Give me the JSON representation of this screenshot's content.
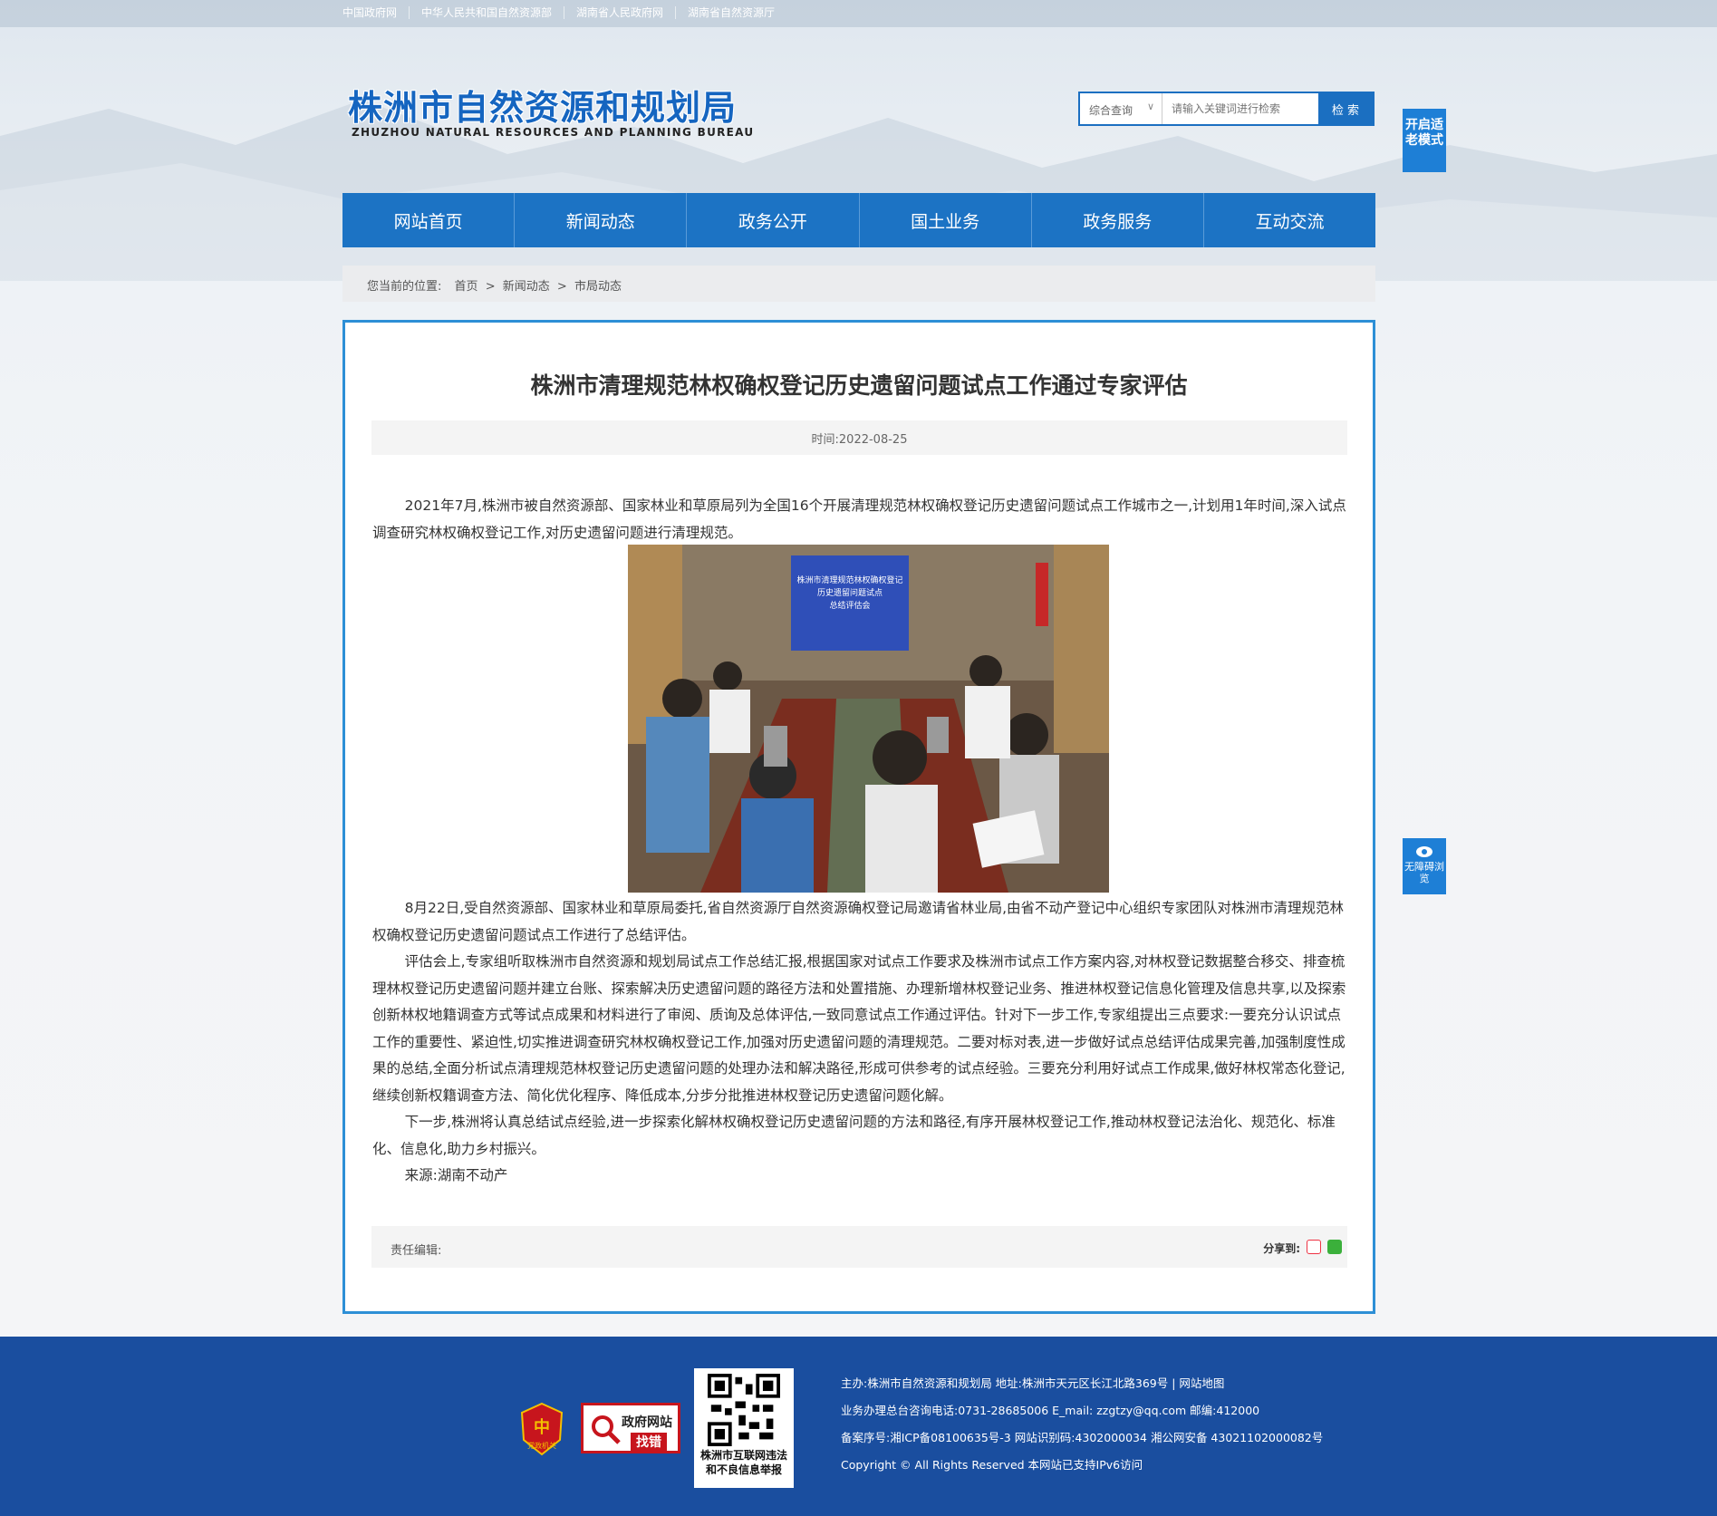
{
  "topbar": {
    "links": [
      "中国政府网",
      "中华人民共和国自然资源部",
      "湖南省人民政府网",
      "湖南省自然资源厅"
    ]
  },
  "header": {
    "logo_cn": "株洲市自然资源和规划局",
    "logo_en": "ZHUZHOU NATURAL RESOURCES AND PLANNING BUREAU",
    "search": {
      "scope": "综合查询",
      "placeholder": "请输入关键词进行检索",
      "button": "检 索"
    },
    "elder_mode": "开启适老模式"
  },
  "nav": [
    "网站首页",
    "新闻动态",
    "政务公开",
    "国土业务",
    "政务服务",
    "互动交流"
  ],
  "breadcrumb": {
    "label": "您当前的位置:",
    "items": [
      "首页",
      ">",
      "新闻动态",
      ">",
      "市局动态"
    ]
  },
  "article": {
    "title": "株洲市清理规范林权确权登记历史遗留问题试点工作通过专家评估",
    "date": "时间:2022-08-25",
    "para1": "2021年7月,株洲市被自然资源部、国家林业和草原局列为全国16个开展清理规范林权确权登记历史遗留问题试点工作城市之一,计划用1年时间,深入试点调查研究林权确权登记工作,对历史遗留问题进行清理规范。",
    "photo_screen": "株洲市清理规范林权确权登记历史遗留问题试点总结评估会",
    "para2": "8月22日,受自然资源部、国家林业和草原局委托,省自然资源厅自然资源确权登记局邀请省林业局,由省不动产登记中心组织专家团队对株洲市清理规范林权确权登记历史遗留问题试点工作进行了总结评估。",
    "para3": "评估会上,专家组听取株洲市自然资源和规划局试点工作总结汇报,根据国家对试点工作要求及株洲市试点工作方案内容,对林权登记数据整合移交、排查梳理林权登记历史遗留问题并建立台账、探索解决历史遗留问题的路径方法和处置措施、办理新增林权登记业务、推进林权登记信息化管理及信息共享,以及探索创新林权地籍调查方式等试点成果和材料进行了审阅、质询及总体评估,一致同意试点工作通过评估。针对下一步工作,专家组提出三点要求:一要充分认识试点工作的重要性、紧迫性,切实推进调查研究林权确权登记工作,加强对历史遗留问题的清理规范。二要对标对表,进一步做好试点总结评估成果完善,加强制度性成果的总结,全面分析试点清理规范林权登记历史遗留问题的处理办法和解决路径,形成可供参考的试点经验。三要充分利用好试点工作成果,做好林权常态化登记,继续创新权籍调查方法、简化优化程序、降低成本,分步分批推进林权登记历史遗留问题化解。",
    "para4": "下一步,株洲将认真总结试点经验,进一步探索化解林权确权登记历史遗留问题的方法和路径,有序开展林权登记工作,推动林权登记法治化、规范化、标准化、信息化,助力乡村振兴。",
    "source": "来源:湖南不动产",
    "editor_label": "责任编辑:",
    "share_label": "分享到:"
  },
  "accessibility": "无障碍浏览",
  "footer": {
    "badge_party": "党政机关",
    "badge_error_1": "政府网站",
    "badge_error_2": "找错",
    "qr_caption": "株洲市互联网违法和不良信息举报",
    "line1": "主办:株洲市自然资源和规划局 地址:株洲市天元区长江北路369号 | 网站地图",
    "line2": "业务办理总台咨询电话:0731-28685006 E_mail: zzgtzy@qq.com 邮编:412000",
    "line3": "备案序号:湘ICP备08100635号-3 网站识别码:4302000034 湘公网安备 43021102000082号",
    "line4": "Copyright © All Rights Reserved 本网站已支持IPv6访问"
  },
  "colors": {
    "primary": "#1c73c4",
    "panel_border": "#2d8fd6",
    "footer_bg": "#1a4e9f",
    "badge_red": "#c7151d"
  }
}
